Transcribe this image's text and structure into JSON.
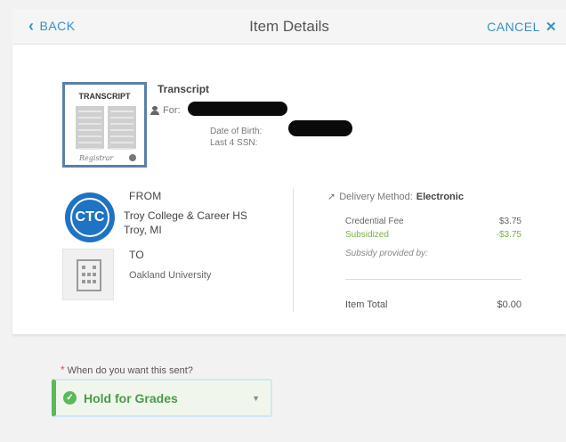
{
  "header": {
    "back_label": "BACK",
    "title": "Item Details",
    "cancel_label": "CANCEL"
  },
  "item": {
    "thumb_title": "TRANSCRIPT",
    "name": "Transcript",
    "for_label": "For:",
    "dob_label": "Date of Birth:",
    "ssn_label": "Last 4 SSN:"
  },
  "from": {
    "heading": "FROM",
    "name": "Troy College & Career HS",
    "location": "Troy, MI",
    "logo_text": "CTC"
  },
  "to": {
    "heading": "TO",
    "name": "Oakland University"
  },
  "delivery": {
    "label": "Delivery Method:",
    "value": "Electronic"
  },
  "fees": {
    "credential_label": "Credential Fee",
    "credential_value": "$3.75",
    "subsidized_label": "Subsidized",
    "subsidized_value": "-$3.75",
    "subsidy_label": "Subsidy provided by:",
    "total_label": "Item Total",
    "total_value": "$0.00"
  },
  "send": {
    "question": "When do you want this sent?",
    "selected": "Hold for Grades"
  },
  "colors": {
    "accent": "#3a8fc6",
    "success": "#5cb85c",
    "required": "#d9534f"
  }
}
